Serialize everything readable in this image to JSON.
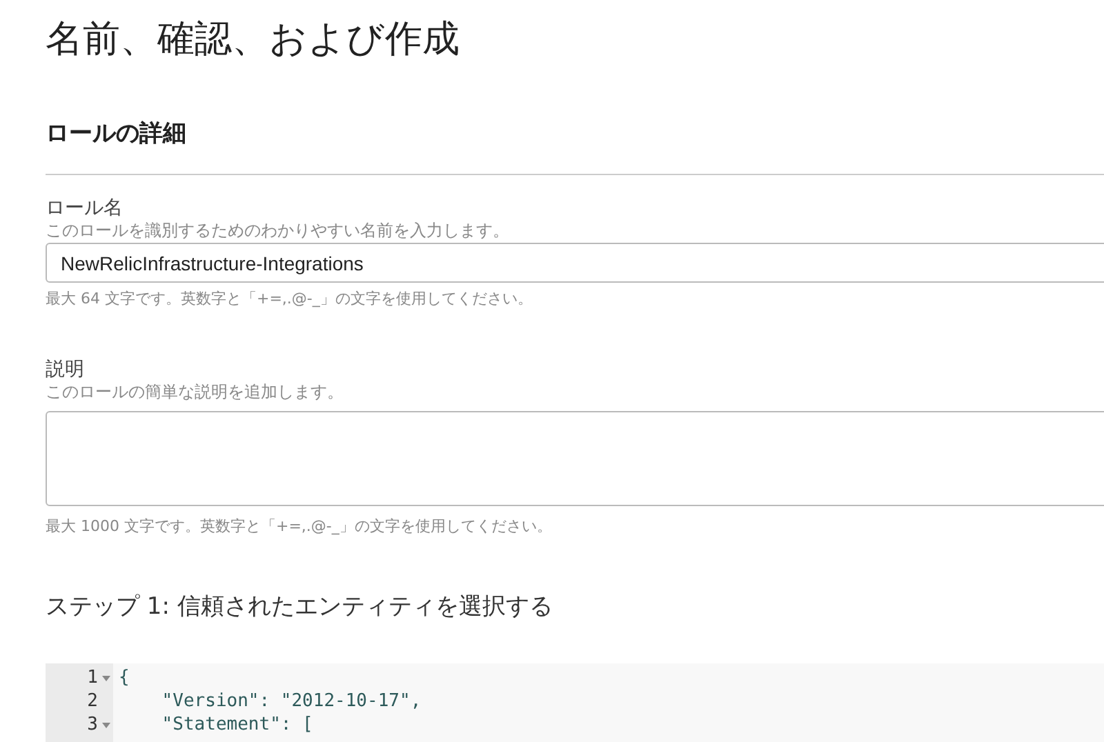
{
  "page_title": "名前、確認、および作成",
  "section_title": "ロールの詳細",
  "fields": [
    {
      "kind": "input",
      "label": "ロール名",
      "hint": "このロールを識別するためのわかりやすい名前を入力します。",
      "value": "NewRelicInfrastructure-Integrations",
      "note": "最大 64 文字です。英数字と「+=,.@-_」の文字を使用してください。"
    },
    {
      "kind": "textarea",
      "label": "説明",
      "hint": "このロールの簡単な説明を追加します。",
      "note": "最大 1000 文字です。英数字と「+=,.@-_」の文字を使用してください。"
    }
  ],
  "step_title": "ステップ 1: 信頼されたエンティティを選択する",
  "editor": {
    "lines": [
      {
        "number": "1",
        "foldable": true,
        "code": "{"
      },
      {
        "number": "2",
        "foldable": false,
        "code": "    \"Version\": \"2012-10-17\","
      },
      {
        "number": "3",
        "foldable": true,
        "code": "    \"Statement\": ["
      }
    ]
  }
}
